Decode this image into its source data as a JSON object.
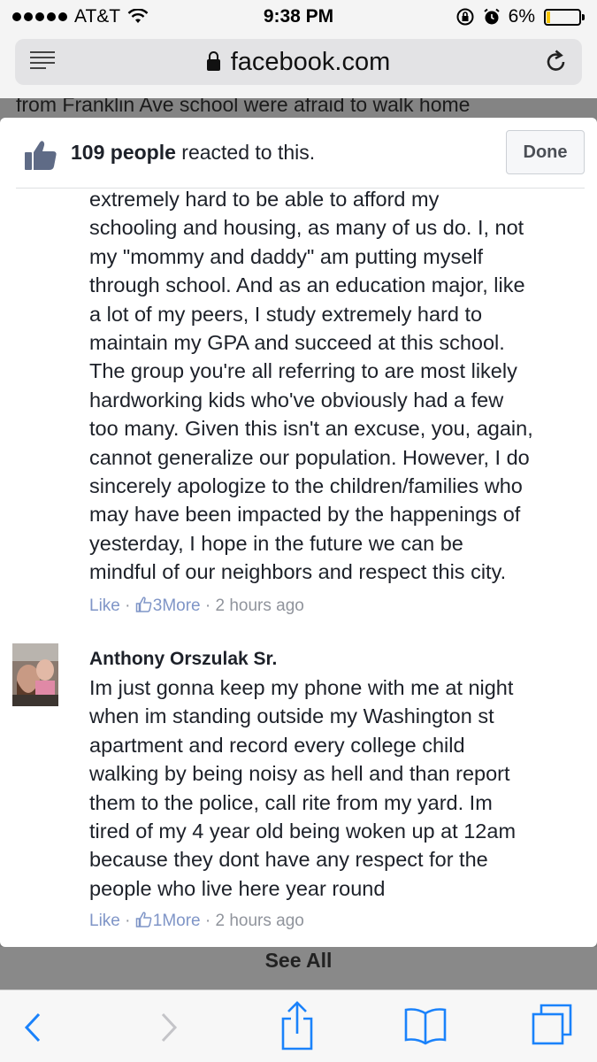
{
  "status_bar": {
    "carrier": "AT&T",
    "time": "9:38 PM",
    "battery": "6%"
  },
  "browser": {
    "url": "facebook.com"
  },
  "background_page": {
    "partial_text": "from Franklin Ave school were afraid to walk home"
  },
  "reactions_modal": {
    "reaction_count": "109 people",
    "reaction_suffix": " reacted to this.",
    "done_label": "Done",
    "comments": [
      {
        "lines": [
          "extremely hard to be able to afford my",
          "schooling and housing, as many of us do. I, not",
          "my \"mommy and daddy\" am putting myself",
          "through school. And as an education major, like",
          "a lot of my peers, I study extremely hard to",
          "maintain my GPA and succeed at this school.",
          "The group you're all referring to are most likely",
          "hardworking kids who've obviously had a few",
          "too many. Given this isn't an excuse, you, again,",
          "cannot generalize our population. However, I do",
          "sincerely apologize to the children/families who",
          "may have been impacted by the happenings of",
          "yesterday, I hope in the future we can be",
          "mindful of our neighbors and respect this city."
        ],
        "like_label": "Like",
        "reactions_label": "3More",
        "time": "2 hours ago"
      },
      {
        "author": "Anthony Orszulak Sr.",
        "lines": [
          "Im just gonna keep my phone with me at night",
          "when im standing outside my Washington st",
          "apartment and record every college child",
          "walking by being noisy as hell and than report",
          "them to the police, call rite from my yard. Im",
          "tired of my 4 year old being woken up at 12am",
          "because they dont have any respect for the",
          "people who live here year round"
        ],
        "like_label": "Like",
        "reactions_label": "1More",
        "time": "2 hours ago"
      }
    ],
    "see_all_label": "See All"
  },
  "meta_separator": "·",
  "colors": {
    "link": "#7f95c7",
    "meta": "#90949c",
    "ios_blue": "#1a82fb"
  }
}
